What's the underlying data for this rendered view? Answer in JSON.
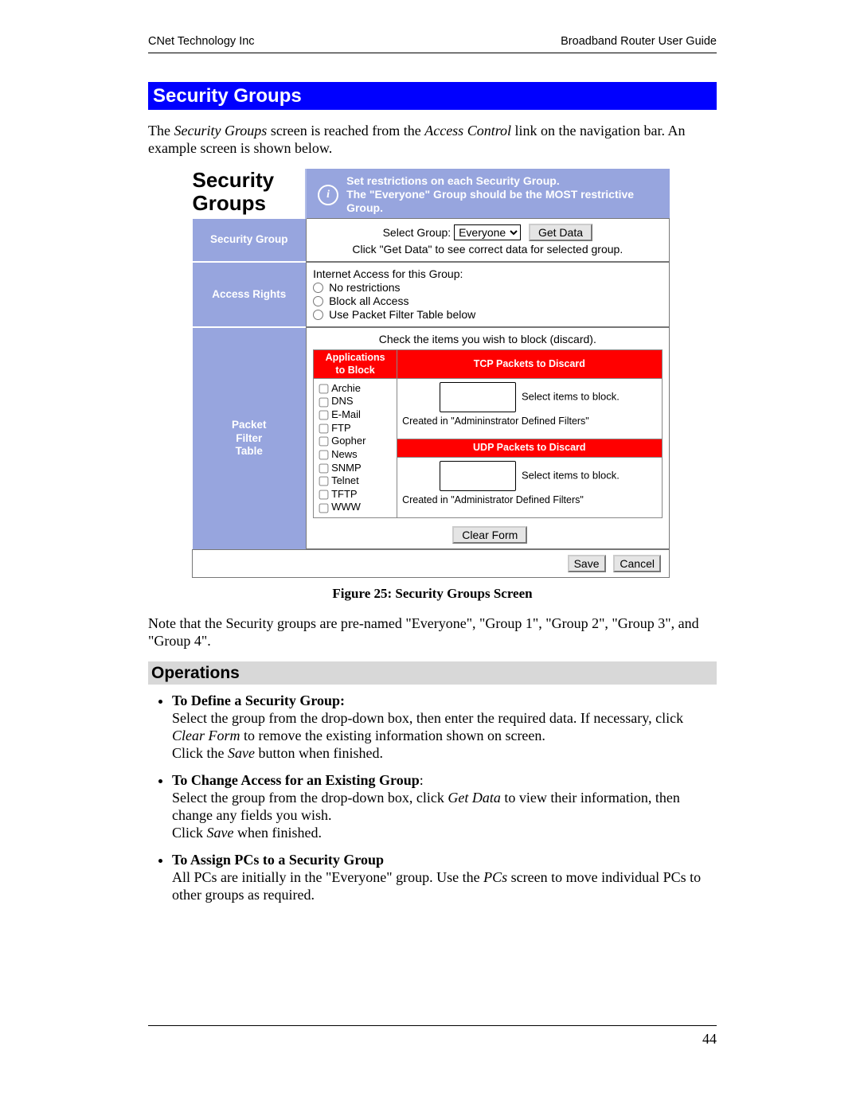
{
  "header": {
    "left": "CNet Technology Inc",
    "right": "Broadband Router User Guide"
  },
  "page_number": "44",
  "section_title": "Security Groups",
  "intro": {
    "pre": "The ",
    "em1": "Security Groups",
    "mid": " screen is reached from the ",
    "em2": "Access Control",
    "post": " link on the navigation bar. An example screen is shown below."
  },
  "figure": {
    "title_l1": "Security",
    "title_l2": "Groups",
    "info_l1": "Set restrictions on each Security Group.",
    "info_l2": "The \"Everyone\" Group should be the MOST restrictive Group.",
    "rows": {
      "security_group": {
        "label": "Security Group",
        "select_label": "Select Group:",
        "selected": "Everyone",
        "get_data_btn": "Get Data",
        "hint": "Click \"Get Data\" to see correct data for selected group."
      },
      "access_rights": {
        "label": "Access Rights",
        "heading": "Internet Access for this Group:",
        "opts": [
          "No restrictions",
          "Block all Access",
          "Use Packet Filter Table below"
        ]
      },
      "packet": {
        "label_l1": "Packet",
        "label_l2": "Filter",
        "label_l3": "Table",
        "instruction": "Check the items you wish to block (discard).",
        "apps_header_l1": "Applications",
        "apps_header_l2": "to Block",
        "tcp_header": "TCP Packets to Discard",
        "udp_header": "UDP Packets to Discard",
        "apps": [
          "Archie",
          "DNS",
          "E-Mail",
          "FTP",
          "Gopher",
          "News",
          "SNMP",
          "Telnet",
          "TFTP",
          "WWW"
        ],
        "select_items": "Select items to block.",
        "created_tcp": "Created in \"Admininstrator Defined Filters\"",
        "created_udp": "Created in \"Administrator Defined Filters\"",
        "clear_btn": "Clear Form"
      }
    },
    "save_btn": "Save",
    "cancel_btn": "Cancel",
    "caption": "Figure 25: Security Groups Screen"
  },
  "note_text": "Note that the Security groups are pre-named \"Everyone\", \"Group 1\", \"Group 2\", \"Group 3\", and \"Group 4\".",
  "operations": {
    "heading": "Operations",
    "items": [
      {
        "title": "To Define a Security Group:",
        "line1_a": "Select the group from the drop-down box, then enter the required data. If necessary, click ",
        "line1_em": "Clear Form",
        "line1_b": " to remove the existing information shown on screen.",
        "line2_a": "Click the ",
        "line2_em": "Save",
        "line2_b": " button when finished."
      },
      {
        "title": "To Change Access for an Existing Group",
        "title_suffix": ":",
        "line1_a": "Select the group from the drop-down box, click ",
        "line1_em": "Get Data",
        "line1_b": " to view their information, then change any fields you wish.",
        "line2_a": "Click ",
        "line2_em": "Save",
        "line2_b": " when finished."
      },
      {
        "title": "To Assign PCs to a Security Group",
        "line1_a": "All PCs are initially in the \"Everyone\" group. Use the ",
        "line1_em": "PCs",
        "line1_b": " screen to move individual PCs to other groups as required."
      }
    ]
  }
}
